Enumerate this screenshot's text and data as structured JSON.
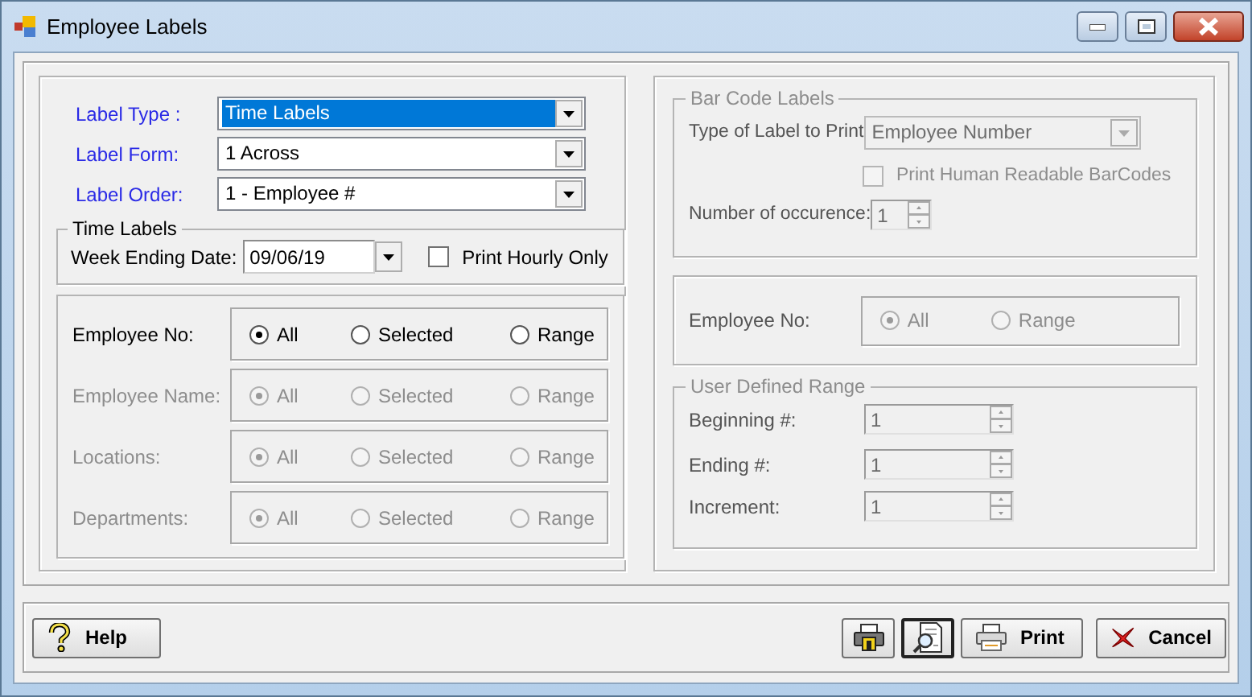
{
  "window": {
    "title": "Employee Labels"
  },
  "label_settings": [
    {
      "label": "Label Type :",
      "value": "Time Labels",
      "highlighted": true
    },
    {
      "label": "Label Form:",
      "value": "1 Across",
      "highlighted": false
    },
    {
      "label": "Label Order:",
      "value": "1 - Employee #",
      "highlighted": false
    }
  ],
  "time_labels": {
    "title": "Time Labels",
    "week_ending_label": "Week Ending Date:",
    "week_ending_value": "09/06/19",
    "print_hourly": {
      "label": "Print Hourly Only",
      "checked": false
    }
  },
  "filters": [
    {
      "label": "Employee No:",
      "disabled": false,
      "options": [
        {
          "label": "All",
          "selected": true
        },
        {
          "label": "Selected",
          "selected": false
        },
        {
          "label": "Range",
          "selected": false
        }
      ]
    },
    {
      "label": "Employee Name:",
      "disabled": true,
      "options": [
        {
          "label": "All",
          "selected": true
        },
        {
          "label": "Selected",
          "selected": false
        },
        {
          "label": "Range",
          "selected": false
        }
      ]
    },
    {
      "label": "Locations:",
      "disabled": true,
      "options": [
        {
          "label": "All",
          "selected": true
        },
        {
          "label": "Selected",
          "selected": false
        },
        {
          "label": "Range",
          "selected": false
        }
      ]
    },
    {
      "label": "Departments:",
      "disabled": true,
      "options": [
        {
          "label": "All",
          "selected": true
        },
        {
          "label": "Selected",
          "selected": false
        },
        {
          "label": "Range",
          "selected": false
        }
      ]
    }
  ],
  "bar_code_labels": {
    "title": "Bar Code Labels",
    "disabled": true,
    "type_label": "Type of Label to Print",
    "type_value": "Employee Number",
    "human_readable": {
      "label": "Print Human Readable BarCodes",
      "checked": false
    },
    "occurrence_label": "Number of occurence:",
    "occurrence_value": "1"
  },
  "barcode_employee": {
    "label": "Employee No:",
    "disabled": true,
    "options": [
      {
        "label": "All",
        "selected": true
      },
      {
        "label": "Range",
        "selected": false
      }
    ]
  },
  "user_defined_range": {
    "title": "User Defined Range",
    "disabled": true,
    "fields": [
      {
        "label": "Beginning #:",
        "value": "1"
      },
      {
        "label": "Ending #:",
        "value": "1"
      },
      {
        "label": "Increment:",
        "value": "1"
      }
    ]
  },
  "buttons": [
    {
      "kind": "help",
      "label": "Help",
      "focused": false
    },
    {
      "kind": "setup",
      "focused": false
    },
    {
      "kind": "preview",
      "focused": true
    },
    {
      "kind": "print",
      "label": "Print",
      "focused": false
    },
    {
      "kind": "cancel",
      "label": "Cancel",
      "focused": false
    }
  ]
}
